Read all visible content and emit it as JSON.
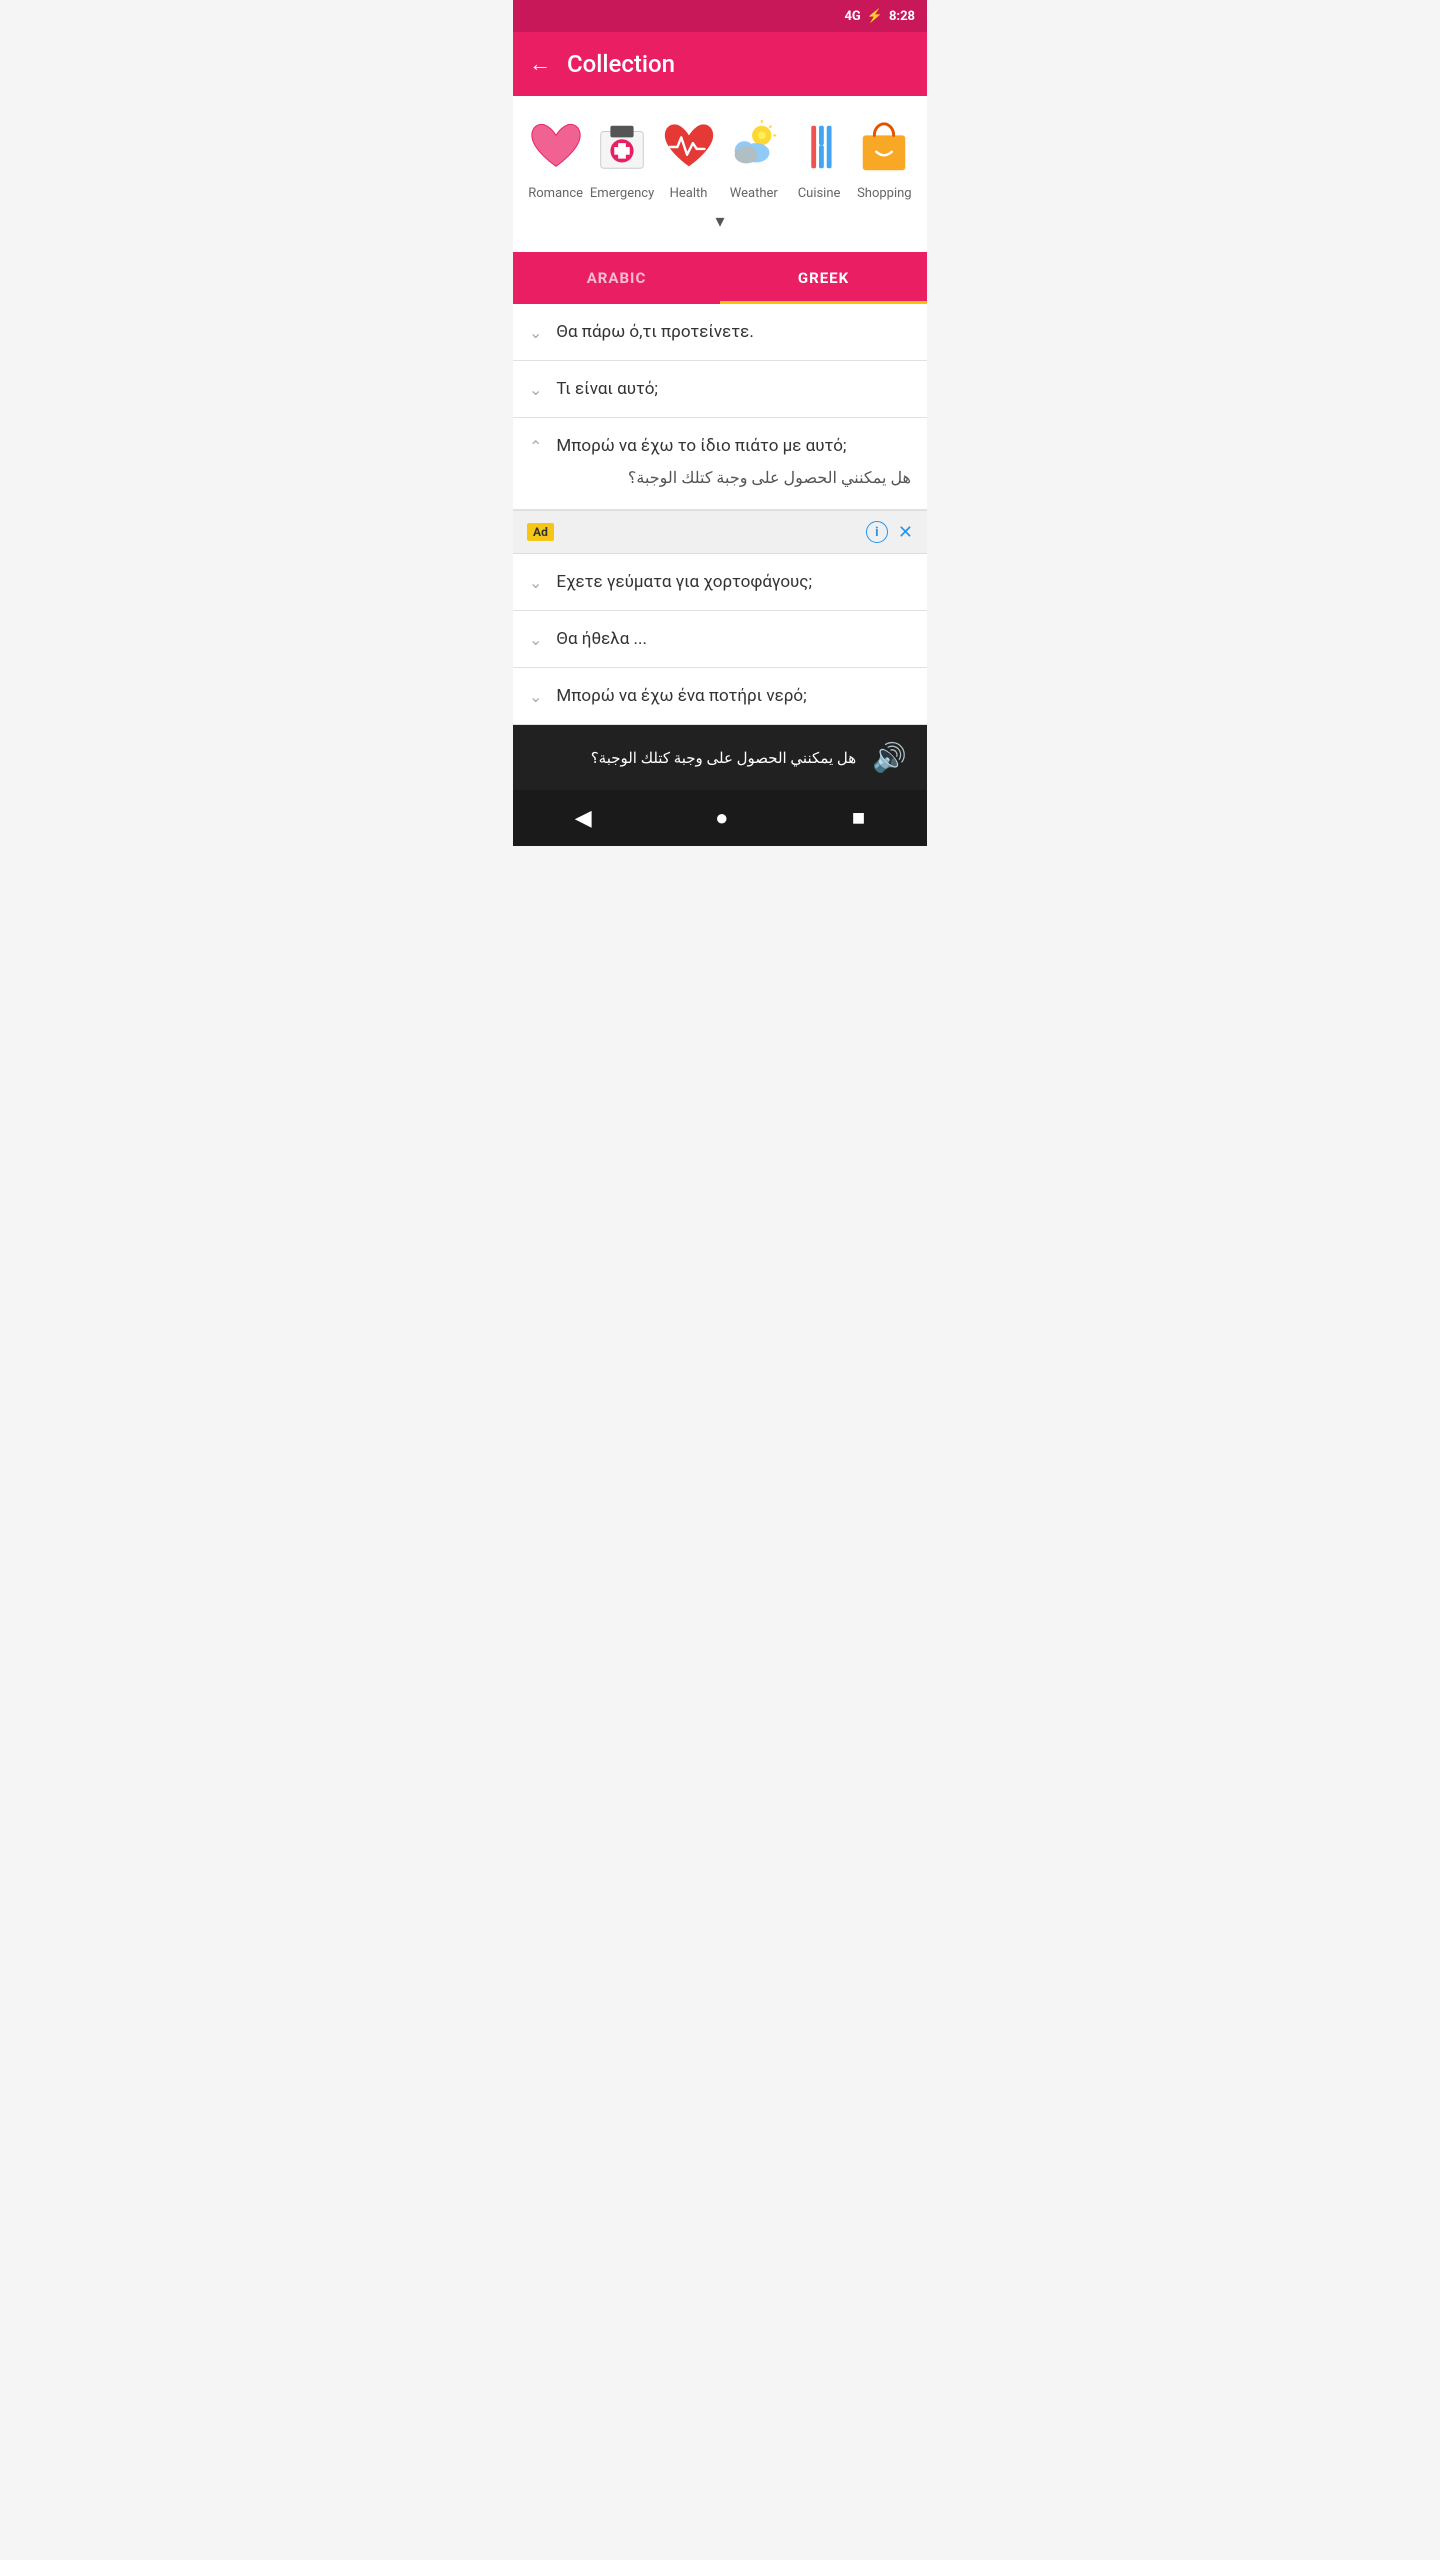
{
  "statusBar": {
    "signal": "4G",
    "time": "8:28"
  },
  "header": {
    "title": "Collection",
    "backLabel": "←"
  },
  "categories": [
    {
      "id": "romance",
      "label": "Romance",
      "iconType": "heart"
    },
    {
      "id": "emergency",
      "label": "Emergency",
      "iconType": "medical"
    },
    {
      "id": "health",
      "label": "Health",
      "iconType": "heartbeat"
    },
    {
      "id": "weather",
      "label": "Weather",
      "iconType": "weather"
    },
    {
      "id": "cuisine",
      "label": "Cuisine",
      "iconType": "cuisine"
    },
    {
      "id": "shopping",
      "label": "Shopping",
      "iconType": "shopping"
    }
  ],
  "expandLabel": "▾",
  "tabs": [
    {
      "id": "arabic",
      "label": "ARABIC",
      "active": false
    },
    {
      "id": "greek",
      "label": "GREEK",
      "active": true
    }
  ],
  "phrases": [
    {
      "id": 1,
      "text": "Θα πάρω ό,τι προτείνετε.",
      "expanded": false,
      "translation": null
    },
    {
      "id": 2,
      "text": "Τι είναι αυτό;",
      "expanded": false,
      "translation": null
    },
    {
      "id": 3,
      "text": "Μπορώ να έχω το ίδιο πιάτο με αυτό;",
      "expanded": true,
      "translation": "هل يمكنني الحصول على وجبة كتلك الوجبة؟"
    },
    {
      "id": 4,
      "text": "Εχετε γεύματα για χορτοφάγους;",
      "expanded": false,
      "translation": null
    },
    {
      "id": 5,
      "text": "Θα ήθελα ...",
      "expanded": false,
      "translation": null
    },
    {
      "id": 6,
      "text": "Μπορώ να έχω ένα ποτήρι νερό;",
      "expanded": false,
      "translation": null
    }
  ],
  "ad": {
    "label": "Ad"
  },
  "bottomBar": {
    "text": "هل يمكنني الحصول على وجبة كتلك الوجبة؟",
    "speakerIcon": "🔊"
  },
  "navBar": {
    "back": "◀",
    "home": "●",
    "square": "■"
  }
}
